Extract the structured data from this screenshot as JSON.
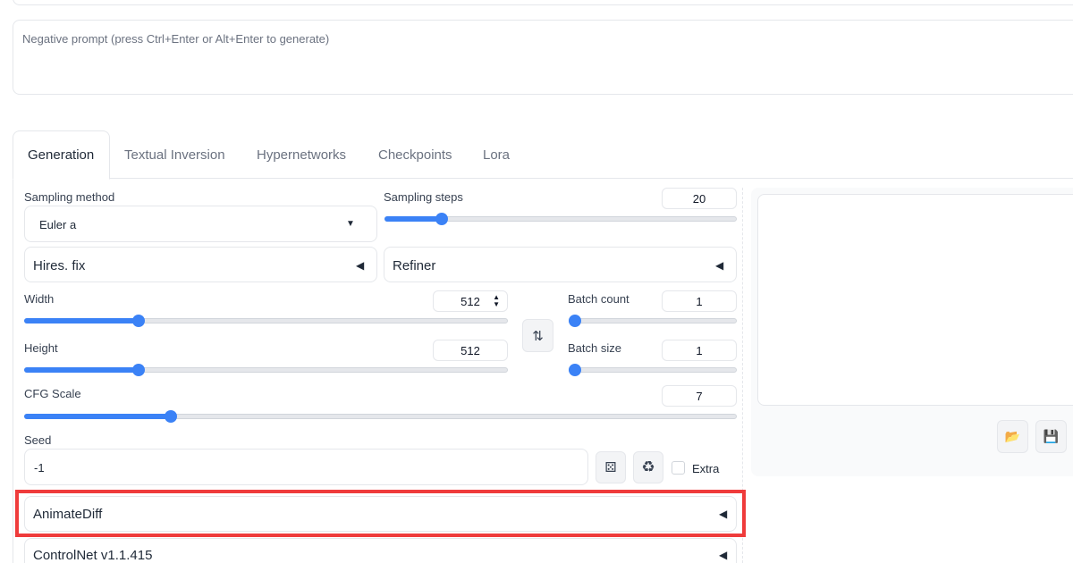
{
  "prompt": {
    "value": ""
  },
  "negative_prompt": {
    "placeholder": "Negative prompt (press Ctrl+Enter or Alt+Enter to generate)"
  },
  "tabs": [
    {
      "label": "Generation",
      "active": true
    },
    {
      "label": "Textual Inversion",
      "active": false
    },
    {
      "label": "Hypernetworks",
      "active": false
    },
    {
      "label": "Checkpoints",
      "active": false
    },
    {
      "label": "Lora",
      "active": false
    }
  ],
  "sampling_method": {
    "label": "Sampling method",
    "value": "Euler a"
  },
  "sampling_steps": {
    "label": "Sampling steps",
    "value": "20",
    "level": 0.15
  },
  "hires_fix": {
    "label": "Hires. fix"
  },
  "refiner": {
    "label": "Refiner"
  },
  "width": {
    "label": "Width",
    "value": "512",
    "level": 0.23
  },
  "height": {
    "label": "Height",
    "value": "512",
    "level": 0.23
  },
  "swap_icon": "swap-arrows-icon",
  "batch_count": {
    "label": "Batch count",
    "value": "1",
    "level": 0.0
  },
  "batch_size": {
    "label": "Batch size",
    "value": "1",
    "level": 0.0
  },
  "cfg_scale": {
    "label": "CFG Scale",
    "value": "7",
    "level": 0.2
  },
  "seed": {
    "label": "Seed",
    "value": "-1",
    "extra_label": "Extra"
  },
  "accordions": {
    "animatediff": "AnimateDiff",
    "controlnet": "ControlNet v1.1.415"
  },
  "colors": {
    "accent": "#3b82f6",
    "highlight": "#ef3b3b"
  },
  "output_icons": [
    "folder-icon",
    "save-icon"
  ]
}
